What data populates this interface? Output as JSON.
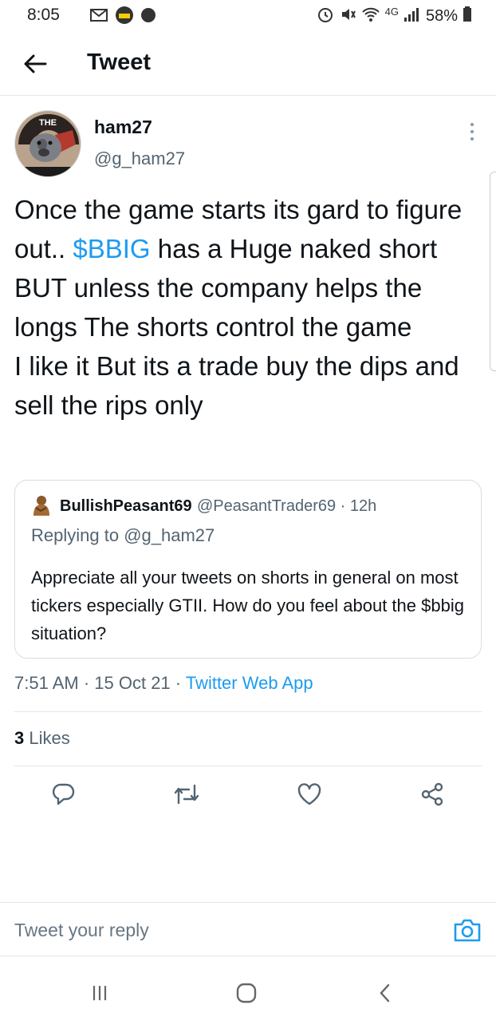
{
  "status_bar": {
    "time": "8:05",
    "network": "4G",
    "battery": "58%",
    "icons": [
      "gmail-icon",
      "fox-bet-icon",
      "vpn-icon",
      "alarm-icon",
      "mute-icon",
      "wifi-icon",
      "signal-icon",
      "battery-icon"
    ]
  },
  "header": {
    "title": "Tweet",
    "back_icon": "arrow-left-icon"
  },
  "tweet": {
    "author_name": "ham27",
    "author_handle": "@g_ham27",
    "text_before": "Once the game starts its gard to figure out.. ",
    "cashtag": "$BBIG",
    "text_after": " has a Huge naked short  BUT unless the company helps the longs The shorts control the game\nI like it But its a trade buy the dips and sell the rips only",
    "time": "7:51 AM",
    "date": "15 Oct 21",
    "source": "Twitter Web App",
    "likes_count": "3",
    "likes_label": "Likes"
  },
  "quote": {
    "author_name": "BullishPeasant69",
    "author_handle": "@PeasantTrader69 · 12h",
    "replying_prefix": "Replying to ",
    "replying_to": "@g_ham27",
    "text": "Appreciate all your tweets on shorts in general on most tickers especially GTII. How do you feel about the $bbig situation?"
  },
  "actions": [
    "reply-icon",
    "retweet-icon",
    "like-icon",
    "share-icon"
  ],
  "reply_bar": {
    "placeholder": "Tweet your reply"
  },
  "colors": {
    "accent": "#1d9bf0",
    "secondary_text": "#536471",
    "divider": "#e6e6e6"
  }
}
